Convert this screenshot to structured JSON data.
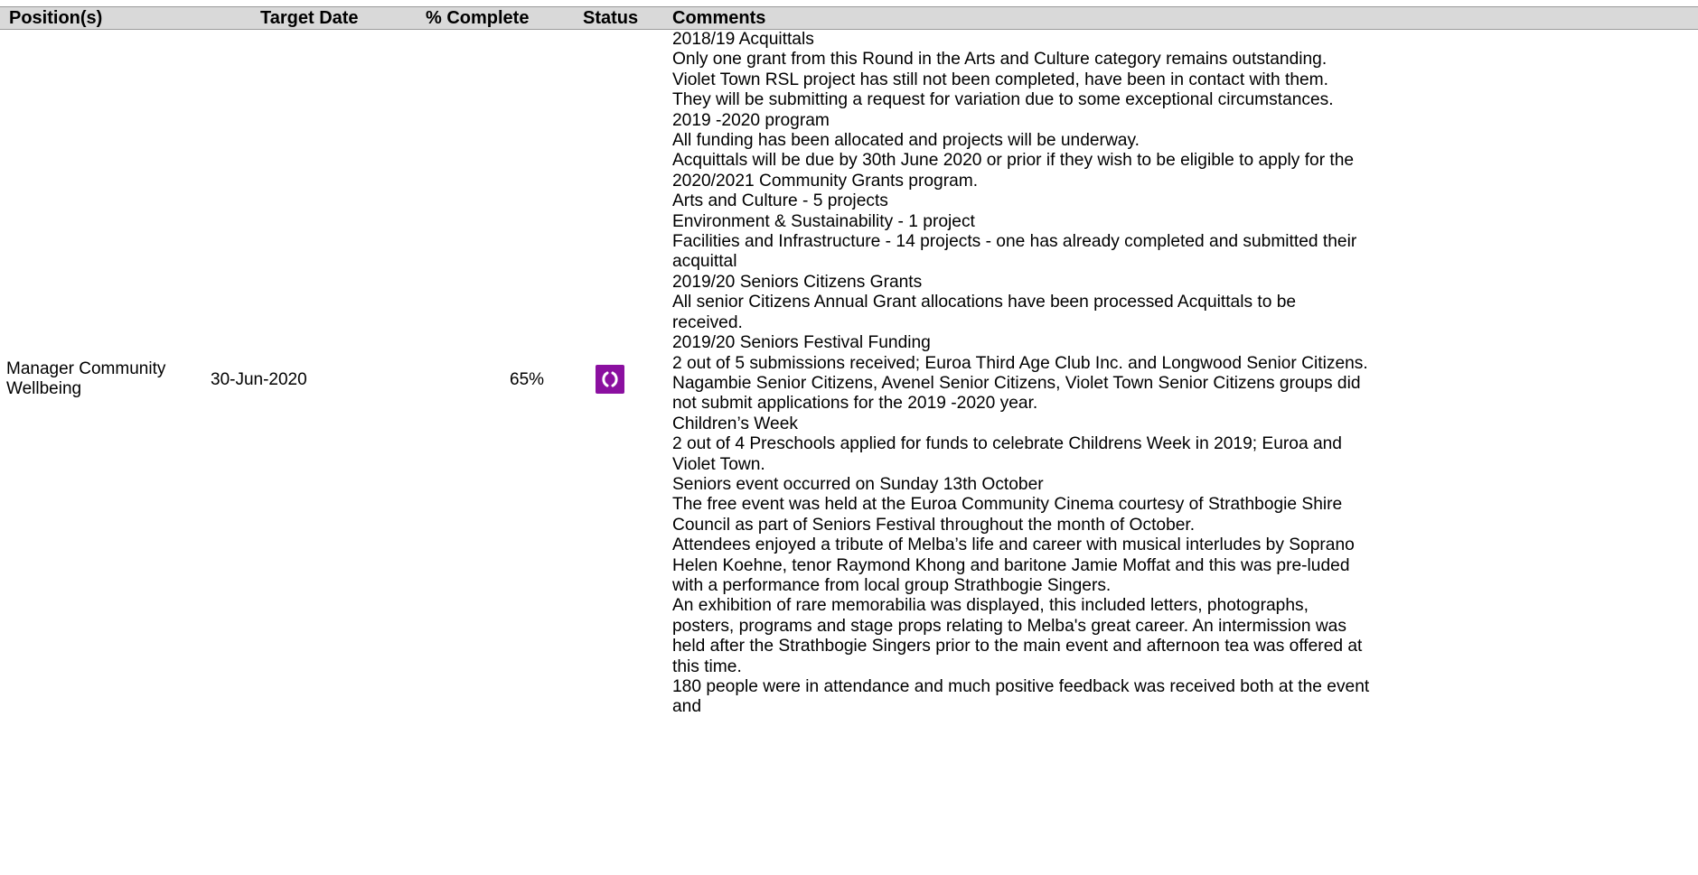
{
  "table": {
    "headers": {
      "position": "Position(s)",
      "target_date": "Target Date",
      "percent_complete": "% Complete",
      "status": "Status",
      "comments": "Comments"
    },
    "row": {
      "position_line1": "Manager Community",
      "position_line2": "Wellbeing",
      "target_date": "30-Jun-2020",
      "percent_complete": "65%",
      "status_icon": "in-progress-icon",
      "status_color": "#8b10a0",
      "comments": [
        "2018/19 Acquittals",
        "Only one grant from this Round in the Arts and Culture category remains outstanding.",
        "Violet Town RSL project has still not been completed, have been in contact with them.",
        "They will be submitting a request for variation due to some exceptional circumstances.",
        "2019 -2020 program",
        "All funding has been allocated and projects will be underway.",
        "Acquittals will be due by 30th June 2020 or prior if they wish to be eligible to apply for the",
        "2020/2021 Community Grants program.",
        "Arts and Culture - 5 projects",
        "Environment & Sustainability  - 1 project",
        "Facilities and Infrastructure  - 14 projects - one has already completed and submitted their",
        "acquittal",
        "2019/20 Seniors Citizens Grants",
        "All senior Citizens Annual Grant allocations have been processed Acquittals to be",
        "received.",
        "2019/20 Seniors Festival Funding",
        "2 out of 5 submissions received; Euroa Third Age Club Inc. and Longwood Senior Citizens.",
        "Nagambie Senior Citizens, Avenel Senior Citizens, Violet Town Senior Citizens groups did",
        "not submit applications for the 2019 -2020 year.",
        "Children’s Week",
        "2 out of 4 Preschools applied for funds to celebrate Childrens Week in 2019; Euroa and",
        "Violet Town.",
        "Seniors event occurred on Sunday 13th October",
        "The free event was held at the Euroa Community Cinema courtesy of Strathbogie Shire",
        "Council as part of Seniors Festival throughout the month of October.",
        "Attendees enjoyed a tribute of Melba’s life and career with musical interludes by Soprano",
        "Helen Koehne, tenor Raymond Khong and baritone Jamie Moffat and this was pre-luded",
        "with a performance from local group Strathbogie Singers.",
        "An exhibition of rare memorabilia was displayed, this included letters, photographs,",
        "posters, programs and stage props relating to Melba's great career. An intermission was",
        "held after the Strathbogie Singers prior to the main event and afternoon tea was offered at",
        "this time.",
        "180 people were in attendance and much positive feedback was received both at the event",
        "and"
      ]
    }
  }
}
